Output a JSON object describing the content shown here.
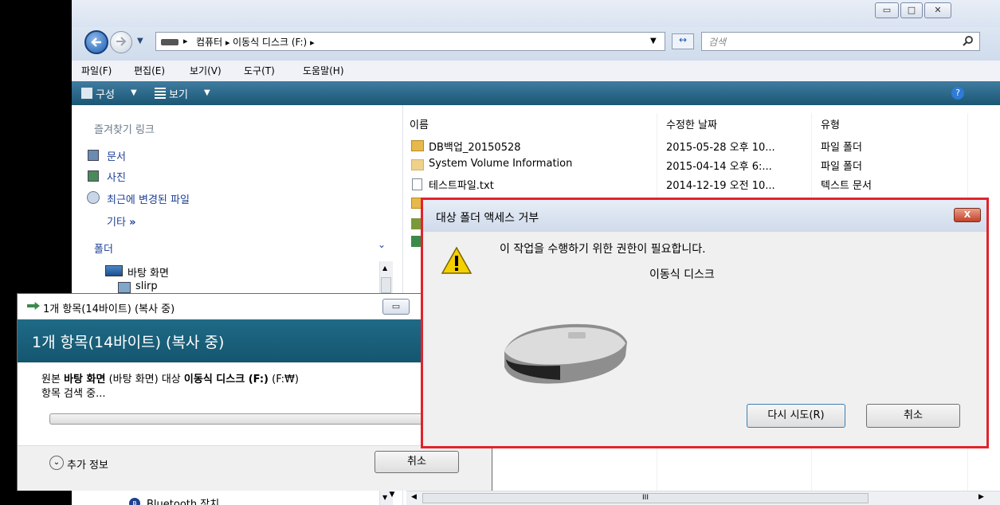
{
  "explorer": {
    "address": {
      "crumbs": [
        "컴퓨터",
        "이동식 디스크 (F:)"
      ],
      "search_placeholder": "검색"
    },
    "menu": [
      "파일(F)",
      "편집(E)",
      "보기(V)",
      "도구(T)",
      "도움말(H)"
    ],
    "toolbar": {
      "organize": "구성",
      "views": "보기"
    },
    "left_pane": {
      "favorites_heading": "즐겨찾기 링크",
      "favorites": [
        "문서",
        "사진",
        "최근에 변경된 파일"
      ],
      "more": "기타",
      "folders_heading": "폴더",
      "tree": [
        "바탕 화면",
        "slirp",
        "Bluetooth 장치"
      ]
    },
    "columns": [
      "이름",
      "수정한 날짜",
      "유형"
    ],
    "files": [
      {
        "name": "DB백업_20150528",
        "date": "2015-05-28 오후 10...",
        "type": "파일 폴더",
        "icon": "folder-icon"
      },
      {
        "name": "System Volume Information",
        "date": "2015-04-14 오후 6:...",
        "type": "파일 폴더",
        "icon": "folder-icon"
      },
      {
        "name": "테스트파일.txt",
        "date": "2014-12-19 오전 10...",
        "type": "텍스트 문서",
        "icon": "text-file-icon"
      }
    ],
    "scroll_grip": "III"
  },
  "copy_dialog": {
    "title": "1개 항목(14바이트) (복사 중)",
    "heading": "1개 항목(14바이트) (복사 중)",
    "line1_prefix": "원본",
    "source": "바탕 화면",
    "source_paren": "(바탕 화면)",
    "dest_label": "대상",
    "dest": "이동식 디스크 (F:)",
    "dest_paren": "(F:₩)",
    "status": "항목 검색 중...",
    "more_info": "추가 정보",
    "cancel": "취소"
  },
  "error_dialog": {
    "title": "대상 폴더 액세스 거부",
    "message": "이 작업을 수행하기 위한 권한이 필요합니다.",
    "device": "이동식 디스크",
    "retry": "다시 시도(R)",
    "cancel": "취소",
    "close_symbol": "X"
  },
  "colors": {
    "highlight_border": "#e0242c",
    "toolbar": "#1b5674",
    "copy_band": "#14566f"
  }
}
